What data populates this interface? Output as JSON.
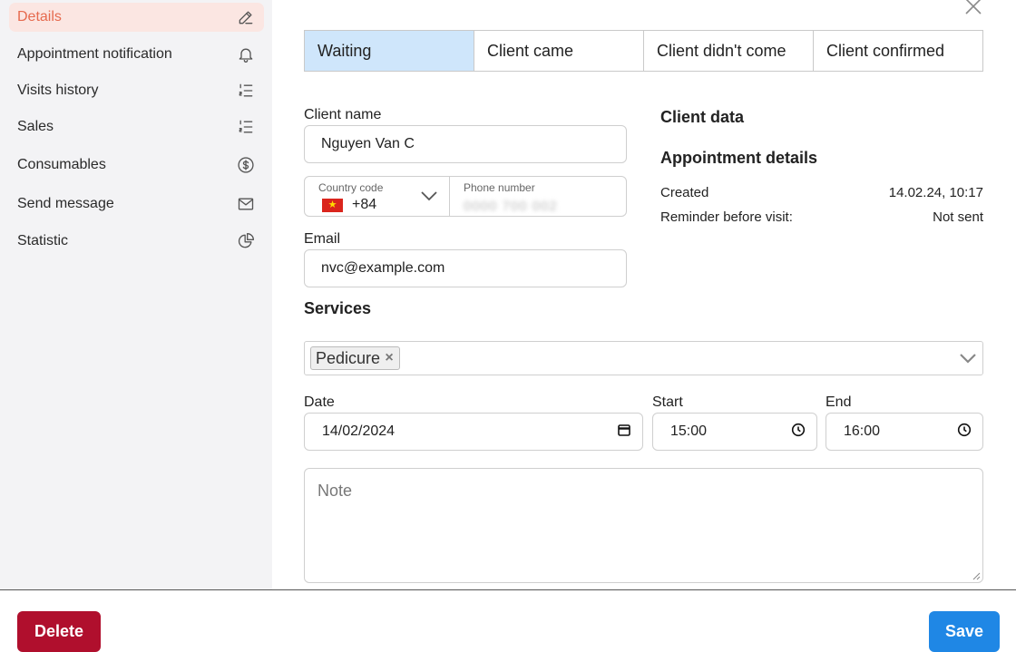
{
  "sidebar": {
    "items": [
      {
        "label": "Details",
        "icon": "pencil-icon"
      },
      {
        "label": "Appointment notification",
        "icon": "bell-icon"
      },
      {
        "label": "Visits history",
        "icon": "list-icon"
      },
      {
        "label": "Sales",
        "icon": "list-icon"
      },
      {
        "label": "Consumables",
        "icon": "dollar-circle-icon"
      },
      {
        "label": "Send message",
        "icon": "mail-icon"
      },
      {
        "label": "Statistic",
        "icon": "pie-chart-icon"
      }
    ],
    "active_color": "#e66a4e"
  },
  "status_tabs": [
    {
      "label": "Waiting",
      "active": true
    },
    {
      "label": "Client came"
    },
    {
      "label": "Client didn't come"
    },
    {
      "label": "Client confirmed"
    }
  ],
  "form": {
    "client_name_label": "Client name",
    "client_name_value": "Nguyen Van C",
    "country_code_label": "Country code",
    "country_code_value": "+84",
    "phone_label": "Phone number",
    "phone_value": "0000 700 002",
    "email_label": "Email",
    "email_value": "nvc@example.com",
    "services_label": "Services",
    "services": [
      "Pedicure"
    ],
    "date_label": "Date",
    "date_value": "14/02/2024",
    "start_label": "Start",
    "start_value": "15:00",
    "end_label": "End",
    "end_value": "16:00",
    "note_placeholder": "Note"
  },
  "client_data": {
    "title": "Client data",
    "appointment_title": "Appointment details",
    "created_label": "Created",
    "created_value": "14.02.24, 10:17",
    "reminder_label": "Reminder before visit:",
    "reminder_value": "Not sent"
  },
  "footer": {
    "delete_label": "Delete",
    "save_label": "Save",
    "delete_color": "#b00f2d",
    "save_color": "#1f87e5"
  }
}
